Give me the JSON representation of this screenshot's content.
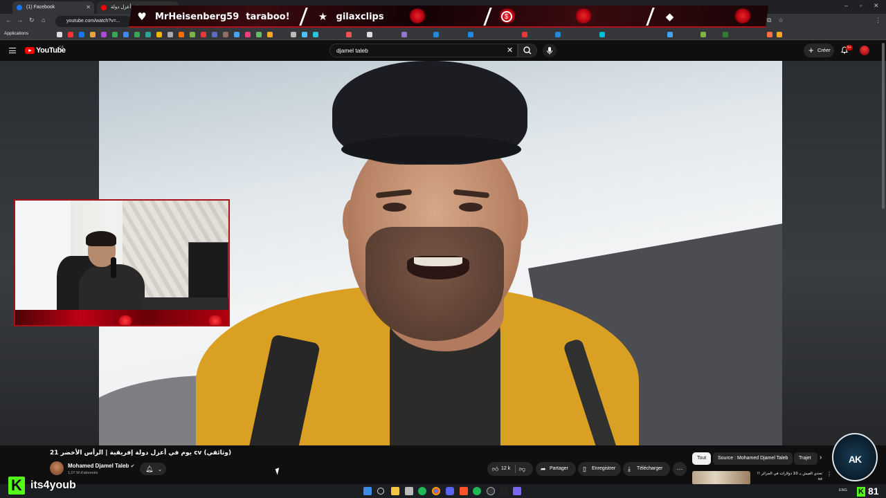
{
  "browser": {
    "tabs": [
      {
        "label": "(1) Facebook",
        "color": "#1877f2"
      },
      {
        "label": "يوم في أعزل دولة",
        "color": "#ff0000"
      }
    ],
    "url": "youtube.com/watch?v=...",
    "bookmarks_label": "Applications"
  },
  "stream_overlay": {
    "items": [
      {
        "icon": "heart-icon",
        "glyph": "♥",
        "text": "MrHeisenberg59"
      },
      {
        "icon": "",
        "glyph": "",
        "text": "taraboo!"
      },
      {
        "icon": "star-icon",
        "glyph": "★",
        "text": "gilaxclips"
      },
      {
        "icon": "dollar-icon",
        "glyph": "$",
        "text": ""
      },
      {
        "icon": "diamond-icon",
        "glyph": "◆",
        "text": ""
      }
    ],
    "accent": "#c20010"
  },
  "youtube": {
    "wordmark": "YouTube",
    "country": "CA",
    "search_value": "djamel taleb",
    "create_label": "Créer",
    "notif_count": "9+",
    "brand_color": "#ff0000"
  },
  "video": {
    "title": "(وثائقي) cv يوم في أعزل دولة إفريقية | الرأس الأخضر 21",
    "channel": "Mohamed Djamel Taleb",
    "subscribers": "1,07 M d'abonnés",
    "likes": "12 k",
    "share_label": "Partager",
    "save_label": "Enregistrer",
    "download_label": "Télécharger",
    "more_label": "⋯"
  },
  "sidebar": {
    "chips": [
      "Tout",
      "Source : Mohamed Djamel Taleb",
      "Trajet"
    ],
    "recommendation_title": "تحدي العيش بـ 10 دولارات في الجزائر !! oz"
  },
  "kick": {
    "handle": "its4youb",
    "count": "81",
    "color": "#53fc18"
  },
  "emblem_text": "AK",
  "taskbar": {
    "language": "ENG"
  }
}
